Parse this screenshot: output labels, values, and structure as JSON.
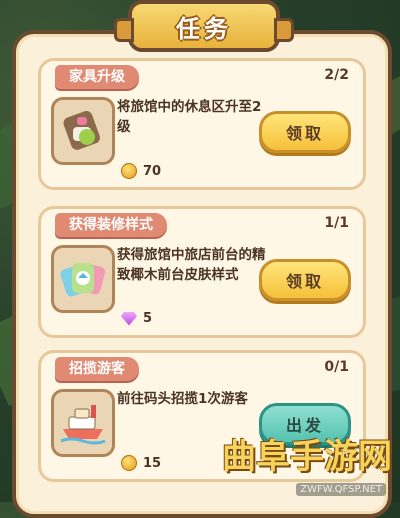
{
  "header": {
    "title": "任务"
  },
  "tasks": [
    {
      "tag": "家具升级",
      "progress": "2/2",
      "description": "将旅馆中的休息区升至2级",
      "reward_amount": "70",
      "reward_icon": "coin-icon",
      "button_label": "领取",
      "button_color": "#f6c13a",
      "thumb_icon": "furniture-icon"
    },
    {
      "tag": "获得装修样式",
      "progress": "1/1",
      "description": "获得旅馆中旅店前台的精致椰木前台皮肤样式",
      "reward_amount": "5",
      "reward_icon": "gem-icon",
      "button_label": "领取",
      "button_color": "#f6c13a",
      "thumb_icon": "style-cards-icon"
    },
    {
      "tag": "招揽游客",
      "progress": "0/1",
      "description": "前往码头招揽1次游客",
      "reward_amount": "15",
      "reward_icon": "coin-icon",
      "button_label": "出发",
      "button_color": "#55c2b2",
      "thumb_icon": "ship-icon"
    }
  ],
  "watermark": {
    "text": "曲阜手游网",
    "url": "ZWFW.QFSP.NET"
  }
}
